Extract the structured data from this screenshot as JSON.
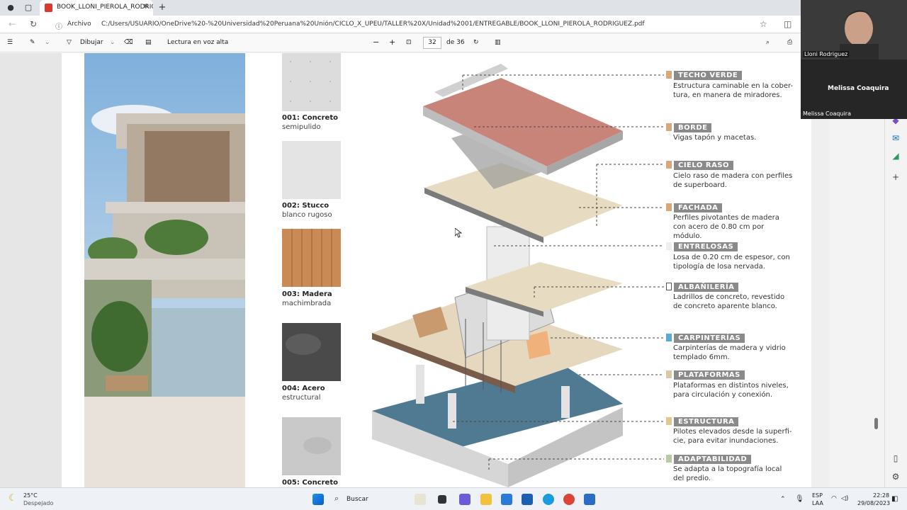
{
  "browser": {
    "tab_title": "BOOK_LLONI_PIEROLA_RODRIGUEZ.pdf",
    "tab_close": "✕",
    "new_tab": "+",
    "address_label": "Archivo",
    "url": "C:/Users/USUARIO/OneDrive%20-%20Universidad%20Peruana%20Unión/CICLO_X_UPEU/TALLER%20X/Unidad%2001/ENTREGABLE/BOOK_LLONI_PIEROLA_RODRIGUEZ.pdf"
  },
  "pdf_toolbar": {
    "draw_label": "Dibujar",
    "read_aloud_label": "Lectura en voz alta",
    "zoom_out": "−",
    "zoom_in": "+",
    "page_current": "32",
    "page_total": "de 36"
  },
  "materials": [
    {
      "code": "001: Concreto",
      "desc": "semipulido",
      "color": "#dcdcdc"
    },
    {
      "code": "002: Stucco",
      "desc": "blanco rugoso",
      "color": "#e8e8e8"
    },
    {
      "code": "003: Madera",
      "desc": "machimbrada",
      "color": "#c98a55"
    },
    {
      "code": "004: Acero",
      "desc": "estructural",
      "color": "#4a4a4a"
    },
    {
      "code": "005: Concreto",
      "desc": "",
      "color": "#c9c9c9"
    }
  ],
  "legend": [
    {
      "title": "TECHO VERDE",
      "desc": "Estructura caminable en la cober-tura, en manera de miradores.",
      "mark": "#d9a87a"
    },
    {
      "title": "BORDE",
      "desc": "Vigas tapón y macetas.",
      "mark": "#d9a87a"
    },
    {
      "title": "CIELO RASO",
      "desc": "Cielo raso de madera con perfiles de superboard.",
      "mark": "#d9a87a"
    },
    {
      "title": "FACHADA",
      "desc": "Perfiles pivotantes de madera con acero de 0.80 cm por módulo.",
      "mark": "#d9a87a"
    },
    {
      "title": "ENTRELOSAS",
      "desc": "Losa de 0.20 cm de espesor, con tipología de losa nervada.",
      "mark": "#eeeeee"
    },
    {
      "title": "ALBAÑILERÍA",
      "desc": "Ladrillos de concreto, revestido de concreto aparente blanco.",
      "mark": "#ffffff"
    },
    {
      "title": "CARPINTERÍAS",
      "desc": "Carpinterías de madera y vidrio templado 6mm.",
      "mark": "#5aa9d6"
    },
    {
      "title": "PLATAFORMAS",
      "desc": "Plataformas en distintos niveles, para circulación y conexión.",
      "mark": "#d9c7a8"
    },
    {
      "title": "ESTRUCTURA",
      "desc": "Pilotes elevados desde la superfi-cie, para evitar inundaciones.",
      "mark": "#e3c58e"
    },
    {
      "title": "ADAPTABILIDAD",
      "desc": "Se adapta a la topografía local del predio.",
      "mark": "#b9c9a4"
    }
  ],
  "meet": {
    "participant1": "Lloni Rodriguez",
    "participant2_center": "Melissa Coaquira",
    "participant2_label": "Melissa Coaquira"
  },
  "taskbar": {
    "weather_temp": "25°C",
    "weather_desc": "Despejado",
    "search_label": "Buscar",
    "lang1": "ESP",
    "lang2": "LAA",
    "time": "22:28",
    "date": "29/08/2023"
  }
}
